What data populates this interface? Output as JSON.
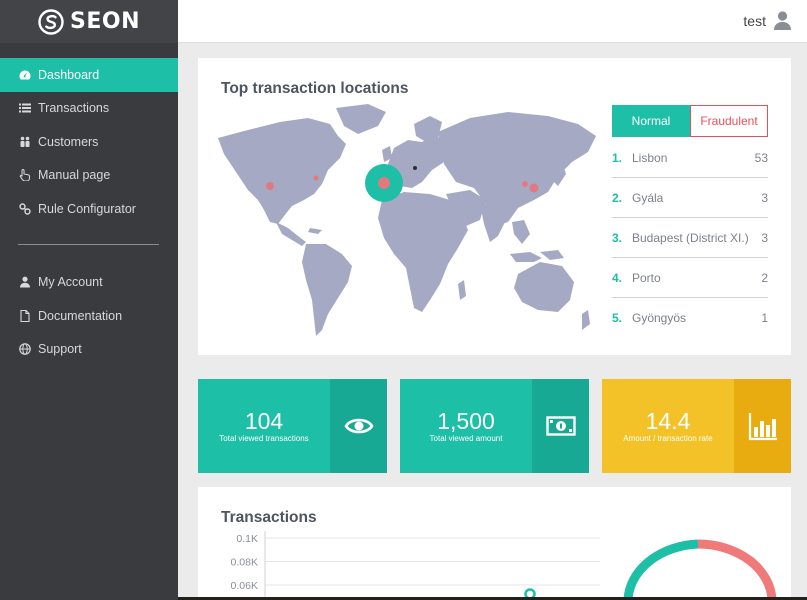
{
  "brand": {
    "name": "SEON"
  },
  "header": {
    "username": "test"
  },
  "sidebar": {
    "items": [
      {
        "label": "Dashboard",
        "icon": "dashboard-icon",
        "active": true
      },
      {
        "label": "Transactions",
        "icon": "list-icon"
      },
      {
        "label": "Customers",
        "icon": "users-icon"
      },
      {
        "label": "Manual page",
        "icon": "hand-pointer-icon"
      },
      {
        "label": "Rule Configurator",
        "icon": "link-icon"
      }
    ],
    "secondary": [
      {
        "label": "My Account",
        "icon": "user-icon"
      },
      {
        "label": "Documentation",
        "icon": "file-icon"
      },
      {
        "label": "Support",
        "icon": "globe-icon"
      }
    ]
  },
  "locations": {
    "title": "Top transaction locations",
    "tabs": {
      "normal": "Normal",
      "fraudulent": "Fraudulent",
      "active": "normal"
    },
    "list": [
      {
        "rank": "1.",
        "name": "Lisbon",
        "count": "53"
      },
      {
        "rank": "2.",
        "name": "Gyála",
        "count": "3"
      },
      {
        "rank": "3.",
        "name": "Budapest (District XI.)",
        "count": "3"
      },
      {
        "rank": "4.",
        "name": "Porto",
        "count": "2"
      },
      {
        "rank": "5.",
        "name": "Gyöngyös",
        "count": "1"
      }
    ]
  },
  "stats": [
    {
      "value": "104",
      "label": "Total viewed transactions",
      "icon": "eye-icon"
    },
    {
      "value": "1,500",
      "label": "Total viewed amount",
      "icon": "money-icon"
    },
    {
      "value": "14.4",
      "label": "Amount / transaction rate",
      "icon": "bar-chart-icon"
    }
  ],
  "transactions": {
    "title": "Transactions"
  },
  "chart_data": {
    "type": "line",
    "title": "Transactions",
    "y_ticks": [
      "0.1K",
      "0.08K",
      "0.06K"
    ]
  },
  "colors": {
    "accent": "#1dbfa6",
    "fraud": "#e7505a",
    "warning": "#f3c229",
    "sidebar": "#3a3b3f"
  }
}
